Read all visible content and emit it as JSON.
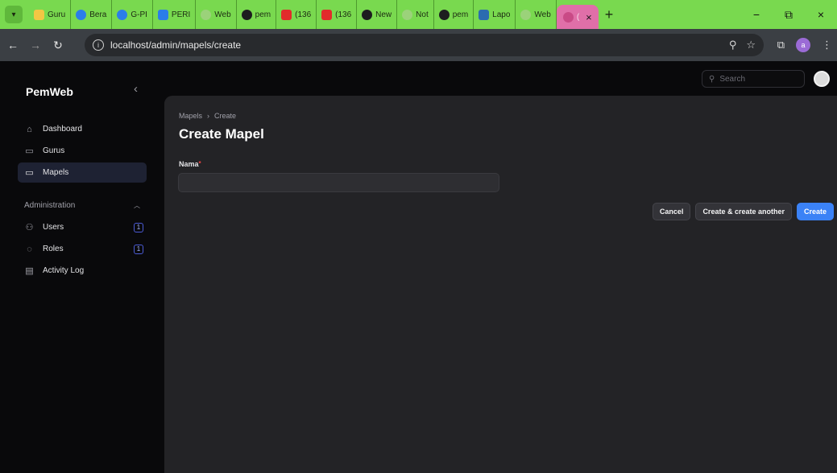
{
  "browser": {
    "tabs": [
      {
        "label": "Guru",
        "color": "#f2c744"
      },
      {
        "label": "Bera",
        "color": "#2b7de9"
      },
      {
        "label": "G-PI",
        "color": "#2b7de9"
      },
      {
        "label": "PERI",
        "color": "#2b7de9"
      },
      {
        "label": "Web",
        "color": "#9bd27a"
      },
      {
        "label": "pem",
        "color": "#1d1d1f"
      },
      {
        "label": "(136",
        "color": "#e22b2b"
      },
      {
        "label": "(136",
        "color": "#e22b2b"
      },
      {
        "label": "New",
        "color": "#1d1d1f"
      },
      {
        "label": "Not",
        "color": "#9bd27a"
      },
      {
        "label": "pem",
        "color": "#1d1d1f"
      },
      {
        "label": "Lapo",
        "color": "#2b6cb0"
      },
      {
        "label": "Web",
        "color": "#9bd27a"
      }
    ],
    "active_tab": {
      "label": "(",
      "close": "×"
    },
    "new_tab": "+",
    "url": "localhost/admin/mapels/create",
    "profile_initial": "a",
    "window_controls": {
      "minimize": "−",
      "maximize": "⧉",
      "close": "×"
    }
  },
  "app": {
    "brand": "PemWeb",
    "nav": [
      {
        "label": "Dashboard",
        "icon": "home-icon",
        "glyph": "⌂"
      },
      {
        "label": "Gurus",
        "icon": "folder-icon",
        "glyph": "▭"
      },
      {
        "label": "Mapels",
        "icon": "folder-icon",
        "glyph": "▭",
        "active": true
      }
    ],
    "admin_group": {
      "label": "Administration",
      "items": [
        {
          "label": "Users",
          "icon": "users-icon",
          "glyph": "⚇",
          "badge": "1"
        },
        {
          "label": "Roles",
          "icon": "shield-icon",
          "glyph": "◌",
          "badge": "1"
        },
        {
          "label": "Activity Log",
          "icon": "log-icon",
          "glyph": "▤"
        }
      ]
    },
    "search_placeholder": "Search",
    "breadcrumb": {
      "parent": "Mapels",
      "separator": "›",
      "current": "Create"
    },
    "page_title": "Create Mapel",
    "form": {
      "nama_label": "Nama",
      "required_mark": "*",
      "nama_value": ""
    },
    "actions": {
      "cancel": "Cancel",
      "create_another": "Create & create another",
      "create": "Create"
    },
    "colors": {
      "primary": "#3b82f6",
      "tab_strip": "#79d94f",
      "active_nav": "#1e2233"
    }
  }
}
